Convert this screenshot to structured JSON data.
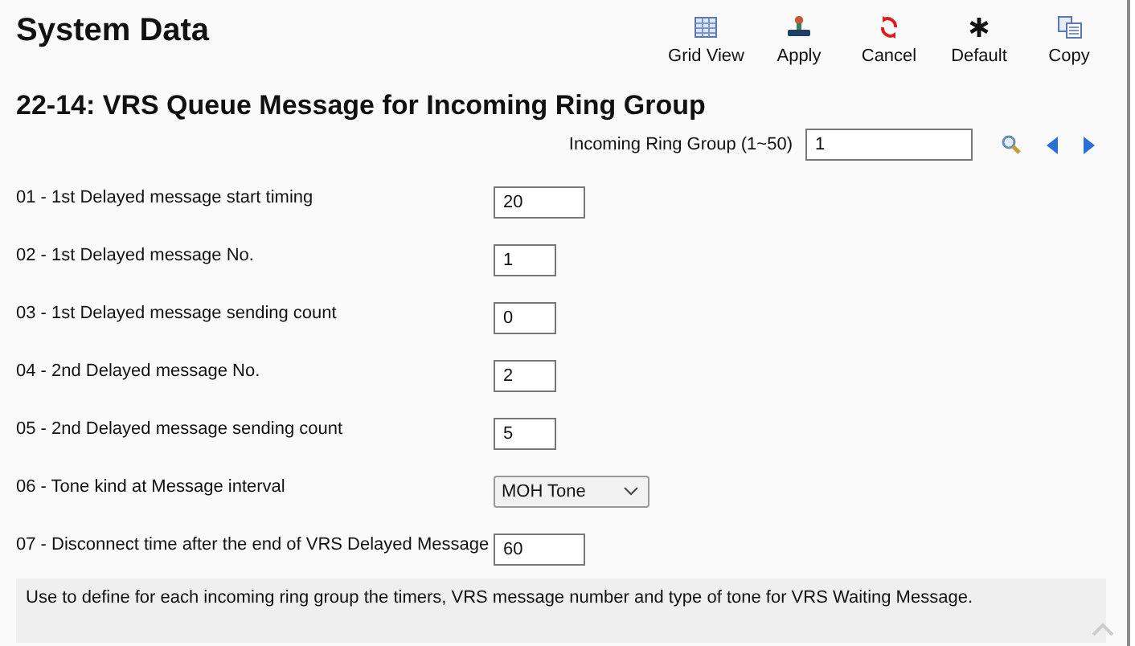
{
  "title": "System Data",
  "toolbar": [
    {
      "label": "Grid View",
      "kind": "grid"
    },
    {
      "label": "Apply",
      "kind": "apply"
    },
    {
      "label": "Cancel",
      "kind": "cancel"
    },
    {
      "label": "Default",
      "kind": "default"
    },
    {
      "label": "Copy",
      "kind": "copy"
    }
  ],
  "heading": "22-14: VRS Queue Message for Incoming Ring Group",
  "selector": {
    "label": "Incoming Ring Group (1~50)",
    "value": "1"
  },
  "fields": [
    {
      "label": "01 - 1st Delayed message start timing",
      "value": "20",
      "kind": "wide"
    },
    {
      "label": "02 - 1st Delayed message No.",
      "value": "1",
      "kind": "narrow"
    },
    {
      "label": "03 - 1st Delayed message sending count",
      "value": "0",
      "kind": "narrow"
    },
    {
      "label": "04 - 2nd Delayed message No.",
      "value": "2",
      "kind": "narrow"
    },
    {
      "label": "05 - 2nd Delayed message sending count",
      "value": "5",
      "kind": "narrow"
    },
    {
      "label": "06 - Tone kind at Message interval",
      "value": "MOH Tone",
      "kind": "select"
    },
    {
      "label": "07 - Disconnect time after the end of VRS Delayed Message",
      "value": "60",
      "kind": "wide"
    }
  ],
  "description": "Use to define for each incoming ring group the timers, VRS message number and type of tone for VRS Waiting Message."
}
